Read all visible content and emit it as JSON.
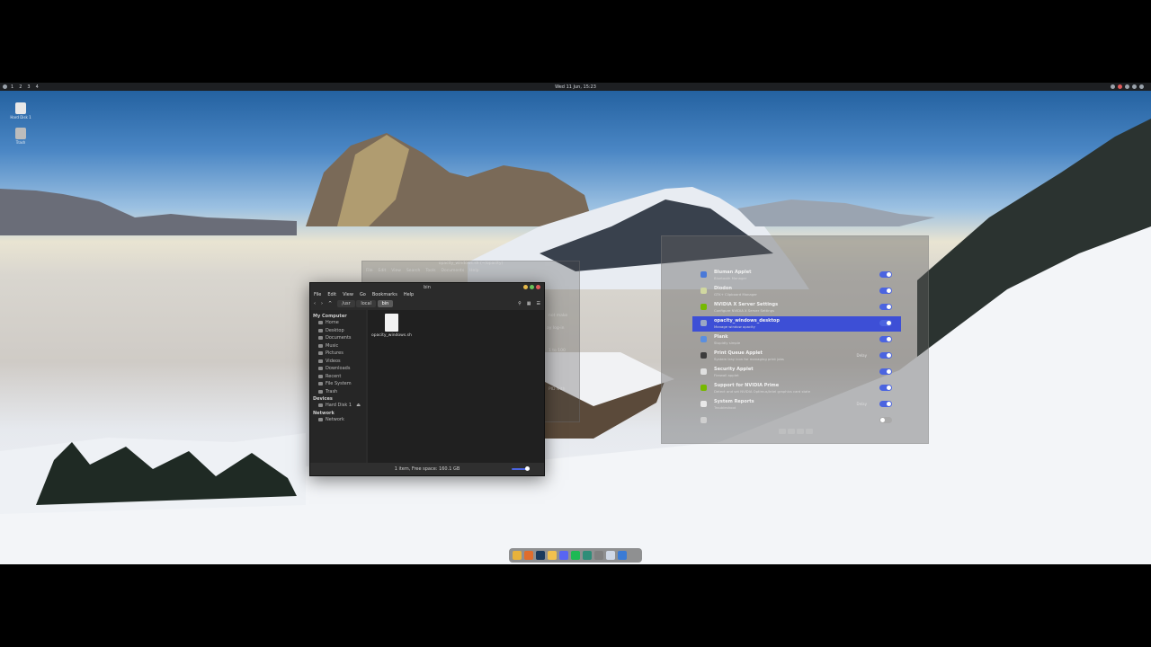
{
  "topbar": {
    "workspaces": [
      "1",
      "2",
      "3",
      "4"
    ],
    "clock": "Wed 11 Jun, 15:23"
  },
  "desktop_icons": [
    {
      "label": "Hard Disk 1",
      "icon": "drive-icon"
    },
    {
      "label": "Trash",
      "icon": "trash-icon"
    }
  ],
  "file_manager": {
    "title": "bin",
    "menu": [
      "File",
      "Edit",
      "View",
      "Go",
      "Bookmarks",
      "Help"
    ],
    "breadcrumbs": [
      "/usr",
      "local",
      "bin"
    ],
    "sidebar": {
      "my_computer": {
        "heading": "My Computer",
        "items": [
          "Home",
          "Desktop",
          "Documents",
          "Music",
          "Pictures",
          "Videos",
          "Downloads",
          "Recent",
          "File System",
          "Trash"
        ]
      },
      "devices": {
        "heading": "Devices",
        "items": [
          "Hard Disk 1"
        ]
      },
      "network": {
        "heading": "Network",
        "items": [
          "Network"
        ]
      }
    },
    "file": {
      "name": "opacity_windows.sh"
    },
    "status": "1 item, Free space: 160.1 GB"
  },
  "ghost_window": {
    "title": "opacity_windows.sh (~/opacity)",
    "menu": [
      "File",
      "Edit",
      "View",
      "Search",
      "Tools",
      "Documents",
      "Help"
    ],
    "lines": [
      "not make",
      "ay log-in",
      "1 to 100",
      "PID with"
    ]
  },
  "startup_apps": [
    {
      "name": "Bluman Applet",
      "desc": "Bluetooth Manager",
      "delay": "",
      "on": true
    },
    {
      "name": "Diodon",
      "desc": "GTK+ Clipboard Manager",
      "delay": "",
      "on": true
    },
    {
      "name": "NVIDIA X Server Settings",
      "desc": "Configure NVIDIA X Server Settings",
      "delay": "",
      "on": true
    },
    {
      "name": "opacity_windows_desktop",
      "desc": "Manage window opacity",
      "delay": "",
      "on": true
    },
    {
      "name": "Plank",
      "desc": "Stupidly simple",
      "delay": "",
      "on": true
    },
    {
      "name": "Print Queue Applet",
      "desc": "System tray icon for managing print jobs",
      "delay": "Delay",
      "on": true
    },
    {
      "name": "Security Applet",
      "desc": "Firewall applet",
      "delay": "",
      "on": true
    },
    {
      "name": "Support for NVIDIA Prime",
      "desc": "Detect and set NVIDIA Optimus/Intel graphics card state",
      "delay": "",
      "on": true
    },
    {
      "name": "System Reports",
      "desc": "Troubleshoot",
      "delay": "Delay",
      "on": true
    },
    {
      "name": "",
      "desc": "",
      "delay": "",
      "on": false
    }
  ],
  "dock": {
    "apps": [
      "files-icon",
      "browser-icon",
      "steam-icon",
      "archive-icon",
      "discord-icon",
      "spotify-icon",
      "terminal-icon",
      "settings-icon",
      "text-editor-icon",
      "window-icon"
    ],
    "colors": [
      "#e9b23a",
      "#e06d2d",
      "#1b3a5c",
      "#f2c14e",
      "#5865f2",
      "#1db954",
      "#2e8d78",
      "#808080",
      "#cfd8e6",
      "#3a7bd5"
    ]
  }
}
